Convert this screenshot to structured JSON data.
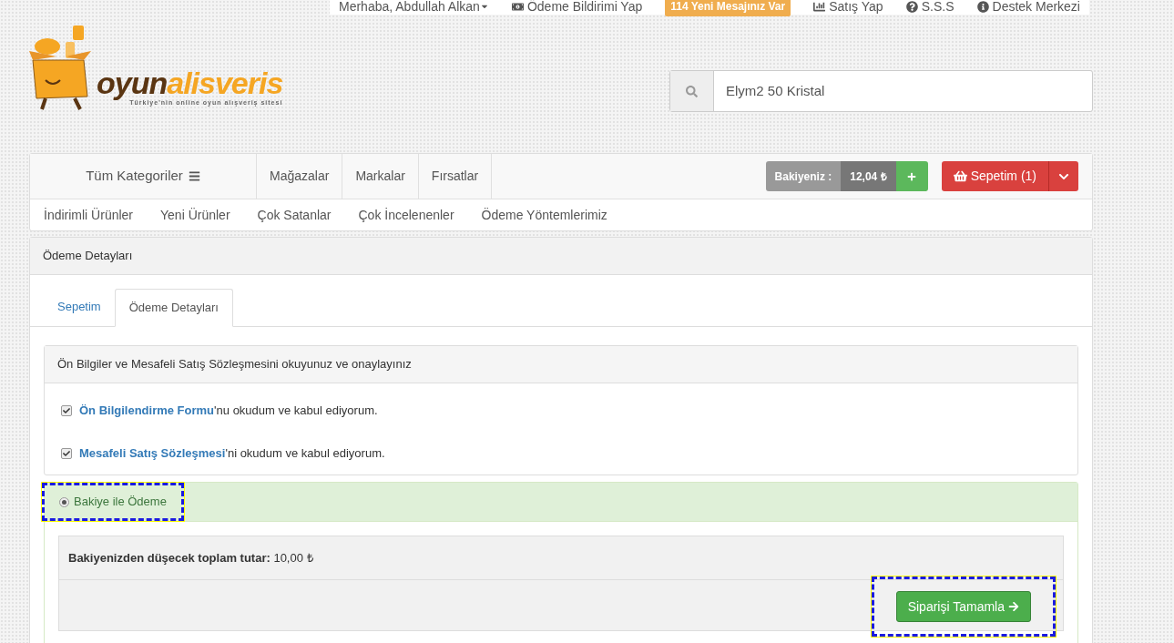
{
  "topbar": {
    "items": [
      {
        "kind": "dropdown",
        "label": "Merhaba, Abdullah Alkan"
      },
      {
        "kind": "link",
        "label": "Ödeme Bildirimi Yap"
      },
      {
        "kind": "badge",
        "label": "114 Yeni Mesajınız Var"
      },
      {
        "kind": "link",
        "label": "Satış Yap"
      },
      {
        "kind": "link",
        "label": "S.S.S"
      },
      {
        "kind": "link",
        "label": "Destek Merkezi"
      }
    ]
  },
  "logo": {
    "part1": "oyun",
    "part2": "alisveris",
    "tagline": "Türkiye'nin online oyun alışveriş sitesi"
  },
  "search": {
    "value": "Elym2 50 Kristal"
  },
  "nav": {
    "categories": "Tüm Kategoriler",
    "links": [
      "Mağazalar",
      "Markalar",
      "Fırsatlar"
    ],
    "balance_label": "Bakiyeniz :",
    "balance": "12,04 ₺",
    "cart": "Sepetim (1)",
    "sublinks": [
      "İndirimli Ürünler",
      "Yeni Ürünler",
      "Çok Satanlar",
      "Çok İncelenenler",
      "Ödeme Yöntemlerimiz"
    ]
  },
  "panel": {
    "title": "Ödeme Detayları",
    "tabs": [
      {
        "label": "Sepetim",
        "selected": false
      },
      {
        "label": "Ödeme Detayları",
        "selected": true
      }
    ],
    "agreement": {
      "title": "Ön Bilgiler ve Mesafeli Satış Sözleşmesini okuyunuz ve onaylayınız",
      "items": [
        {
          "link": "Ön Bilgilendirme Formu",
          "text": "'nu okudum ve kabul ediyorum.",
          "checked": true
        },
        {
          "link": "Mesafeli Satış Sözleşmesi",
          "text": "'ni okudum ve kabul ediyorum.",
          "checked": true
        }
      ]
    },
    "payment": {
      "label": "Bakiye ile Ödeme",
      "selected": true,
      "total_label": "Bakiyenizden düşecek toplam tutar:",
      "total": "10,00 ₺",
      "button": "Siparişi Tamamla"
    }
  }
}
